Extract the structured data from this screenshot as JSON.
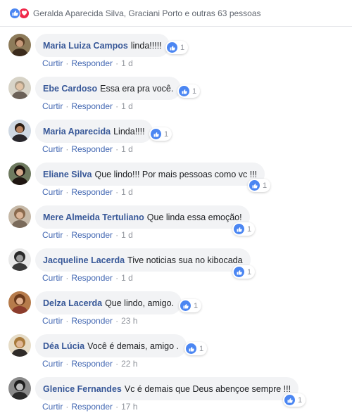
{
  "reactions": {
    "names": "Geralda Aparecida Silva, Graciani Porto e outras 63 pessoas",
    "icons": [
      "like-icon",
      "love-icon"
    ],
    "colors": {
      "like": "#4b86f2",
      "love": "#f0284a"
    }
  },
  "actions": {
    "like_label": "Curtir",
    "reply_label": "Responder",
    "separator": "·"
  },
  "comments": [
    {
      "author": "Maria Luiza Campos",
      "text": "linda!!!!!",
      "reaction_count": "1",
      "time": "1 d"
    },
    {
      "author": "Ebe Cardoso",
      "text": "Essa era pra você.",
      "reaction_count": "1",
      "time": "1 d"
    },
    {
      "author": "Maria Aparecida",
      "text": "Linda!!!!",
      "reaction_count": "1",
      "time": "1 d"
    },
    {
      "author": "Eliane Silva",
      "text": "Que lindo!!! Por mais pessoas como vc !!!",
      "reaction_count": "1",
      "time": "1 d"
    },
    {
      "author": "Mere Almeida Tertuliano",
      "text": "Que linda essa emoção!",
      "reaction_count": "1",
      "time": "1 d"
    },
    {
      "author": "Jacqueline Lacerda",
      "text": "Tive noticias sua no kibocada",
      "reaction_count": "1",
      "time": "1 d"
    },
    {
      "author": "Delza Lacerda",
      "text": "Que lindo, amigo.",
      "reaction_count": "1",
      "time": "23 h"
    },
    {
      "author": "Déa Lúcia",
      "text": "Você é demais, amigo .",
      "reaction_count": "1",
      "time": "22 h"
    },
    {
      "author": "Glenice Fernandes",
      "text": "Vc é demais que Deus abençoe sempre !!!",
      "reaction_count": "1",
      "time": "17 h"
    }
  ]
}
